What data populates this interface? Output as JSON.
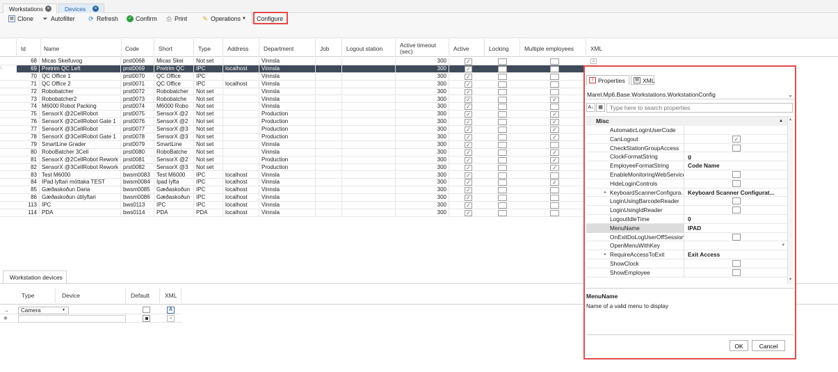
{
  "tabs": [
    {
      "label": "Workstations"
    },
    {
      "label": "Devices"
    }
  ],
  "toolbar": {
    "clone": "Clone",
    "autofilter": "Autofilter",
    "refresh": "Refresh",
    "confirm": "Confirm",
    "print": "Print",
    "operations": "Operations",
    "configure": "Configure"
  },
  "grid": {
    "columns": {
      "id": "Id",
      "name": "Name",
      "code": "Code",
      "short": "Short",
      "type": "Type",
      "address": "Address",
      "department": "Department",
      "job": "Job",
      "logout_station": "Logout station",
      "active_timeout": "Active timeout (sec)",
      "active": "Active",
      "locking": "Locking",
      "multiple_employees": "Multiple employees",
      "xml": "XML"
    },
    "rows": [
      {
        "id": "68",
        "name": "Micas Skeifuvog",
        "code": "prst0068",
        "short": "Micas Skei",
        "type": "Not set",
        "address": "",
        "department": "Vinnsla",
        "timeout": "300",
        "active": true,
        "locking": false,
        "multi": false
      },
      {
        "id": "69",
        "name": "Pretrim QC Left",
        "code": "prst0069",
        "short": "Pretrim QC",
        "type": "IPC",
        "address": "localhost",
        "department": "Vinnsla",
        "timeout": "300",
        "active": true,
        "locking": false,
        "multi": false
      },
      {
        "id": "70",
        "name": "QC Office 1",
        "code": "prst0070",
        "short": "QC Office",
        "type": "IPC",
        "address": "",
        "department": "Vinnsla",
        "timeout": "300",
        "active": true,
        "locking": false,
        "multi": false
      },
      {
        "id": "71",
        "name": "QC Office 2",
        "code": "prst0071",
        "short": "QC Office",
        "type": "IPC",
        "address": "localhost",
        "department": "Vinnsla",
        "timeout": "300",
        "active": true,
        "locking": false,
        "multi": false
      },
      {
        "id": "72",
        "name": "Robobatcher",
        "code": "prst0072",
        "short": "Robobatcher",
        "type": "Not set",
        "address": "",
        "department": "Vinnsla",
        "timeout": "300",
        "active": true,
        "locking": false,
        "multi": false
      },
      {
        "id": "73",
        "name": "Robobatcher2",
        "code": "prst0073",
        "short": "Robobatche",
        "type": "Not set",
        "address": "",
        "department": "Vinnsla",
        "timeout": "300",
        "active": true,
        "locking": false,
        "multi": true
      },
      {
        "id": "74",
        "name": "M6000 Robot Packing",
        "code": "prst0074",
        "short": "M6000 Robo",
        "type": "Not set",
        "address": "",
        "department": "Vinnsla",
        "timeout": "300",
        "active": true,
        "locking": false,
        "multi": false
      },
      {
        "id": "75",
        "name": "SensorX @2CellRobot",
        "code": "prst0075",
        "short": "SensorX @2",
        "type": "Not set",
        "address": "",
        "department": "Production",
        "timeout": "300",
        "active": true,
        "locking": false,
        "multi": true
      },
      {
        "id": "76",
        "name": "SensorX @2CellRobot Gate 1",
        "code": "prst0076",
        "short": "SensorX @2",
        "type": "Not set",
        "address": "",
        "department": "Production",
        "timeout": "300",
        "active": true,
        "locking": false,
        "multi": true
      },
      {
        "id": "77",
        "name": "SensorX @3CellRobot",
        "code": "prst0077",
        "short": "SensorX @3",
        "type": "Not set",
        "address": "",
        "department": "Production",
        "timeout": "300",
        "active": true,
        "locking": false,
        "multi": true
      },
      {
        "id": "78",
        "name": "SensorX @3CellRobot Gate 1",
        "code": "prst0078",
        "short": "SensorX @3",
        "type": "Not set",
        "address": "",
        "department": "Production",
        "timeout": "300",
        "active": true,
        "locking": false,
        "multi": true
      },
      {
        "id": "79",
        "name": "SmartLine Grader",
        "code": "prst0079",
        "short": "SmartLine",
        "type": "Not set",
        "address": "",
        "department": "Vinnsla",
        "timeout": "300",
        "active": true,
        "locking": false,
        "multi": false
      },
      {
        "id": "80",
        "name": "RoboBatcher 3Cell",
        "code": "prst0080",
        "short": "RoboBatche",
        "type": "Not set",
        "address": "",
        "department": "Vinnsla",
        "timeout": "300",
        "active": true,
        "locking": false,
        "multi": true
      },
      {
        "id": "81",
        "name": "SensorX @2CellRobot Rework",
        "code": "prst0081",
        "short": "SensorX @2",
        "type": "Not set",
        "address": "",
        "department": "Production",
        "timeout": "300",
        "active": true,
        "locking": false,
        "multi": true
      },
      {
        "id": "82",
        "name": "SensorX @3CellRobot Rework",
        "code": "prst0082",
        "short": "SensorX @3",
        "type": "Not set",
        "address": "",
        "department": "Production",
        "timeout": "300",
        "active": true,
        "locking": false,
        "multi": true
      },
      {
        "id": "83",
        "name": "Test M6000",
        "code": "bwsm0083",
        "short": "Test M6000",
        "type": "IPC",
        "address": "localhost",
        "department": "Vinnsla",
        "timeout": "300",
        "active": true,
        "locking": false,
        "multi": false
      },
      {
        "id": "84",
        "name": "IPad lyftari móttaka TEST",
        "code": "bwsm0084",
        "short": "Ipad lyfta",
        "type": "IPC",
        "address": "localhost",
        "department": "Vinnsla",
        "timeout": "300",
        "active": true,
        "locking": false,
        "multi": true
      },
      {
        "id": "85",
        "name": "Gæðaskoðun Daria",
        "code": "bwsm0085",
        "short": "Gæðaskoðun",
        "type": "IPC",
        "address": "localhost",
        "department": "Vinnsla",
        "timeout": "300",
        "active": true,
        "locking": false,
        "multi": false
      },
      {
        "id": "86",
        "name": "Gæðaskoðun útilyftari",
        "code": "bwsm0086",
        "short": "Gæðaskoðun",
        "type": "IPC",
        "address": "localhost",
        "department": "Vinnsla",
        "timeout": "300",
        "active": true,
        "locking": false,
        "multi": false
      },
      {
        "id": "113",
        "name": "IPC",
        "code": "bws0113",
        "short": "IPC",
        "type": "IPC",
        "address": "localhost",
        "department": "Vinnsla",
        "timeout": "300",
        "active": true,
        "locking": false,
        "multi": false
      },
      {
        "id": "114",
        "name": "PDA",
        "code": "bws0114",
        "short": "PDA",
        "type": "PDA",
        "address": "localhost",
        "department": "Vinnsla",
        "timeout": "300",
        "active": true,
        "locking": false,
        "multi": false
      }
    ],
    "selected_row_id": "69"
  },
  "workstation_devices": {
    "tab": "Workstation devices",
    "columns": {
      "type": "Type",
      "device": "Device",
      "default": "Default",
      "xml": "XML"
    },
    "rows": [
      {
        "type": "Camera",
        "device": "",
        "default": false
      }
    ]
  },
  "properties": {
    "tab_properties": "Properties",
    "tab_xml": "XML",
    "type_selector": "Marel.Mp6.Base.Workstations.WorkstationConfig",
    "search_placeholder": "Type here to search properties",
    "category": "Misc",
    "items": [
      {
        "name": "AutomaticLoginUserCode",
        "value": "",
        "kind": "text"
      },
      {
        "name": "CanLogout",
        "value": "",
        "kind": "check",
        "checked": true
      },
      {
        "name": "CheckStationGroupAccess",
        "value": "",
        "kind": "check",
        "checked": false
      },
      {
        "name": "ClockFormatString",
        "value": "g",
        "kind": "text"
      },
      {
        "name": "EmployeeFormatString",
        "value": "Code Name",
        "kind": "text"
      },
      {
        "name": "EnableMonitoringWebService",
        "value": "",
        "kind": "check",
        "checked": false
      },
      {
        "name": "HideLoginControls",
        "value": "",
        "kind": "check",
        "checked": false
      },
      {
        "name": "KeyboardScannerConfigura...",
        "value": "Keyboard Scanner Configurat...",
        "kind": "text",
        "expandable": true
      },
      {
        "name": "LoginUsingBarcodeReader",
        "value": "",
        "kind": "check",
        "checked": false
      },
      {
        "name": "LoginUsingIdReader",
        "value": "",
        "kind": "check",
        "checked": false
      },
      {
        "name": "LogoutIdleTime",
        "value": "0",
        "kind": "text"
      },
      {
        "name": "MenuName",
        "value": "IPAD",
        "kind": "text",
        "selected": true
      },
      {
        "name": "OnExitDoLogUserOffSession",
        "value": "",
        "kind": "check",
        "checked": false
      },
      {
        "name": "OpenMenuWithKey",
        "value": "",
        "kind": "dropdown"
      },
      {
        "name": "RequireAccessToExit",
        "value": "Exit Access",
        "kind": "text",
        "expandable": true
      },
      {
        "name": "ShowClock",
        "value": "",
        "kind": "check",
        "checked": false
      },
      {
        "name": "ShowEmployee",
        "value": "",
        "kind": "check",
        "checked": false
      }
    ],
    "description_title": "MenuName",
    "description_text": "Name of a valid menu to display",
    "ok": "OK",
    "cancel": "Cancel"
  },
  "colors": {
    "selected_row": "#3f4a5a",
    "highlight_border": "#e34a4a",
    "active_tab": "#2b66a8"
  }
}
